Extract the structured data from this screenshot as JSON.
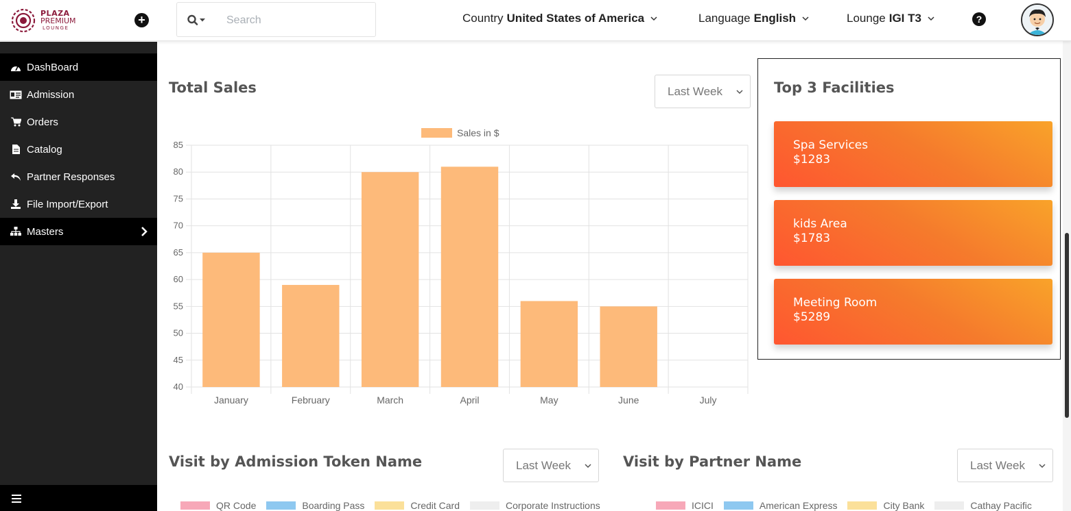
{
  "brand": {
    "line1": "PLAZA",
    "line2": "PREMIUM",
    "line3": "LOUNGE"
  },
  "search": {
    "placeholder": "Search"
  },
  "header": {
    "country": {
      "label": "Country",
      "value": "United States of America"
    },
    "language": {
      "label": "Language",
      "value": "English"
    },
    "lounge": {
      "label": "Lounge",
      "value": "IGI T3"
    }
  },
  "sidebar": {
    "items": [
      {
        "label": "DashBoard",
        "icon": "dashboard-icon"
      },
      {
        "label": "Admission",
        "icon": "id-card-icon"
      },
      {
        "label": "Orders",
        "icon": "cart-icon"
      },
      {
        "label": "Catalog",
        "icon": "file-icon"
      },
      {
        "label": "Partner Responses",
        "icon": "reply-icon"
      },
      {
        "label": "File Import/Export",
        "icon": "download-icon"
      },
      {
        "label": "Masters",
        "icon": "sitemap-icon"
      }
    ]
  },
  "total_sales": {
    "title": "Total Sales",
    "period": "Last Week"
  },
  "chart_data": {
    "type": "bar",
    "title": "",
    "legend": "Sales in $",
    "legend_position": "top",
    "categories": [
      "January",
      "February",
      "March",
      "April",
      "May",
      "June",
      "July"
    ],
    "series": [
      {
        "name": "Sales in $",
        "values": [
          65,
          59,
          80,
          81,
          56,
          55,
          null
        ],
        "color": "#fdba7a"
      }
    ],
    "ylim": [
      40,
      85
    ],
    "yticks": [
      85,
      80,
      75,
      70,
      65,
      60,
      55,
      50,
      45,
      40
    ],
    "grid": true
  },
  "facilities": {
    "title": "Top 3 Facilities",
    "items": [
      {
        "name": "Spa Services",
        "amount": "$1283"
      },
      {
        "name": "kids Area",
        "amount": "$1783"
      },
      {
        "name": "Meeting Room",
        "amount": "$5289"
      }
    ]
  },
  "admission_visits": {
    "title": "Visit by Admission Token Name",
    "period": "Last Week",
    "legend": [
      {
        "label": "QR Code",
        "color": "#f7a8b8"
      },
      {
        "label": "Boarding Pass",
        "color": "#8ec8f0"
      },
      {
        "label": "Credit Card",
        "color": "#fbe09a"
      },
      {
        "label": "Corporate Instructions",
        "color": "#eeeeee"
      }
    ]
  },
  "partner_visits": {
    "title": "Visit by Partner Name",
    "period": "Last Week",
    "legend": [
      {
        "label": "ICICI",
        "color": "#f7a8b8"
      },
      {
        "label": "American Express",
        "color": "#8ec8f0"
      },
      {
        "label": "City Bank",
        "color": "#fbe09a"
      },
      {
        "label": "Cathay Pacific",
        "color": "#eeeeee"
      }
    ]
  }
}
